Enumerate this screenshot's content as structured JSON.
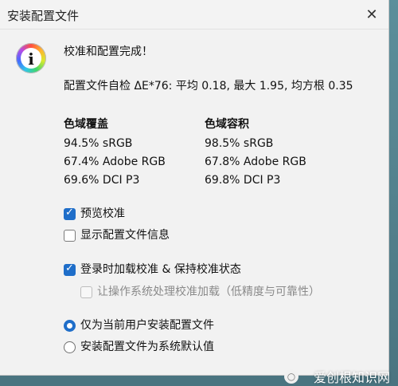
{
  "window": {
    "title": "安装配置文件",
    "close_label": "✕"
  },
  "message": {
    "title": "校准和配置完成！",
    "self_check": "配置文件自检 ΔE*76: 平均 0.18, 最大 1.95, 均方根 0.35"
  },
  "gamut_coverage": {
    "heading": "色域覆盖",
    "items": [
      "94.5% sRGB",
      "67.4% Adobe RGB",
      "69.6% DCI P3"
    ]
  },
  "gamut_volume": {
    "heading": "色域容积",
    "items": [
      "98.5% sRGB",
      "67.8% Adobe RGB",
      "69.8% DCI P3"
    ]
  },
  "options": {
    "preview_calibration": "预览校准",
    "show_profile_info": "显示配置文件信息",
    "load_on_login": "登录时加载校准 & 保持校准状态",
    "let_os_handle": "让操作系统处理校准加载（低精度与可靠性）",
    "install_current_user": "仅为当前用户安装配置文件",
    "install_system_default": "安装配置文件为系统默认值"
  },
  "watermark": {
    "text": "爱创根知识网"
  }
}
